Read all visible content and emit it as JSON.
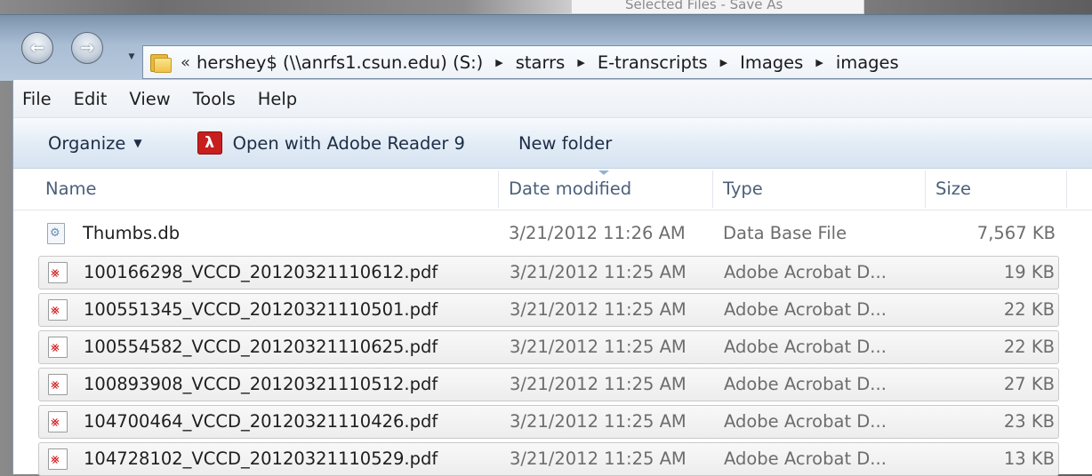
{
  "ghost_window_title": "Selected Files - Save As",
  "navigation": {
    "back_icon": "back-arrow-icon",
    "forward_icon": "forward-arrow-icon",
    "overflow_chevron": "«",
    "breadcrumbs": [
      "hershey$ (\\\\anrfs1.csun.edu) (S:)",
      "starrs",
      "E-transcripts",
      "Images",
      "images"
    ]
  },
  "menu": [
    "File",
    "Edit",
    "View",
    "Tools",
    "Help"
  ],
  "toolbar": {
    "organize": "Organize",
    "open_with": "Open with Adobe Reader 9",
    "new_folder": "New folder"
  },
  "columns": {
    "name": "Name",
    "date": "Date modified",
    "type": "Type",
    "size": "Size"
  },
  "files": [
    {
      "name": "Thumbs.db",
      "date": "3/21/2012 11:26 AM",
      "type": "Data Base File",
      "size": "7,567 KB",
      "icon": "database-file-icon",
      "selected": false
    },
    {
      "name": "100166298_VCCD_20120321110612.pdf",
      "date": "3/21/2012 11:25 AM",
      "type": "Adobe Acrobat D...",
      "size": "19 KB",
      "icon": "pdf-file-icon",
      "selected": true
    },
    {
      "name": "100551345_VCCD_20120321110501.pdf",
      "date": "3/21/2012 11:25 AM",
      "type": "Adobe Acrobat D...",
      "size": "22 KB",
      "icon": "pdf-file-icon",
      "selected": true
    },
    {
      "name": "100554582_VCCD_20120321110625.pdf",
      "date": "3/21/2012 11:25 AM",
      "type": "Adobe Acrobat D...",
      "size": "22 KB",
      "icon": "pdf-file-icon",
      "selected": true
    },
    {
      "name": "100893908_VCCD_20120321110512.pdf",
      "date": "3/21/2012 11:25 AM",
      "type": "Adobe Acrobat D...",
      "size": "27 KB",
      "icon": "pdf-file-icon",
      "selected": true
    },
    {
      "name": "104700464_VCCD_20120321110426.pdf",
      "date": "3/21/2012 11:25 AM",
      "type": "Adobe Acrobat D...",
      "size": "23 KB",
      "icon": "pdf-file-icon",
      "selected": true
    },
    {
      "name": "104728102_VCCD_20120321110529.pdf",
      "date": "3/21/2012 11:25 AM",
      "type": "Adobe Acrobat D...",
      "size": "13 KB",
      "icon": "pdf-file-icon",
      "selected": true
    }
  ]
}
